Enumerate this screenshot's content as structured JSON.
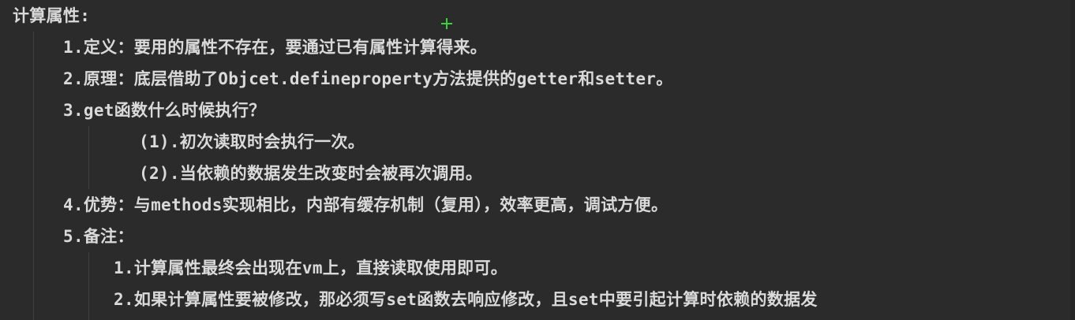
{
  "editor": {
    "lines": [
      "计算属性:",
      "1.定义：要用的属性不存在，要通过已有属性计算得来。",
      "2.原理：底层借助了Objcet.defineproperty方法提供的getter和setter。",
      "3.get函数什么时候执行？",
      "(1).初次读取时会执行一次。",
      "(2).当依赖的数据发生改变时会被再次调用。",
      "4.优势：与methods实现相比，内部有缓存机制（复用），效率更高，调试方便。",
      "5.备注：",
      "1.计算属性最终会出现在vm上，直接读取使用即可。",
      "2.如果计算属性要被修改，那必须写set函数去响应修改，且set中要引起计算时依赖的数据发"
    ]
  },
  "colors": {
    "background": "#2b2b2b",
    "text": "#dadada",
    "cursor": "#3bd13b",
    "indent_guide": "#3f3f3f"
  },
  "icons": {
    "cursor": "crosshair-plus-icon"
  }
}
